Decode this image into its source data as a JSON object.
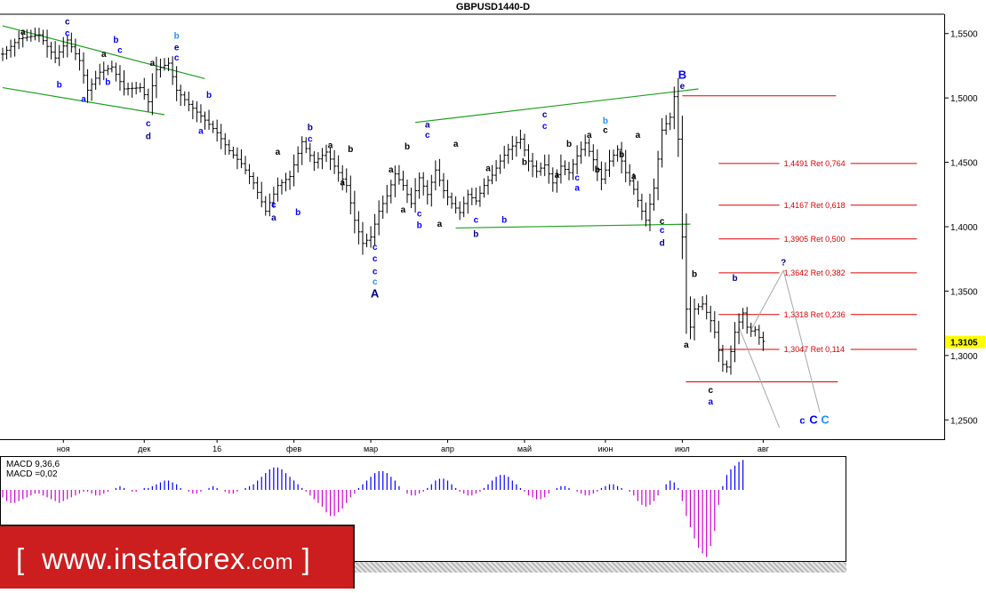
{
  "header": {
    "title": "GBPUSD1440-D"
  },
  "branding": {
    "site": "www.instaforex",
    "tld": ".com",
    "open": "[",
    "close": "]"
  },
  "macd": {
    "name": "MACD 9,36,6",
    "value": "MACD =0,02"
  },
  "chart_data": {
    "type": "ohlc",
    "title": "GBPUSD1440-D",
    "price_axis": {
      "ylim": [
        1.235,
        1.565
      ],
      "ticks": [
        1.25,
        1.3,
        1.35,
        1.4,
        1.45,
        1.5,
        1.55
      ],
      "tick_labels": [
        "1,2500",
        "1,3000",
        "1,3500",
        "1,4000",
        "1,4500",
        "1,5000",
        "1,5500"
      ],
      "current_price": 1.3105,
      "current_label": "1,3105"
    },
    "time_axis": {
      "labels": [
        "ноя",
        "дек",
        "16",
        "фев",
        "мар",
        "апр",
        "май",
        "июн",
        "июл",
        "авг"
      ],
      "label_bar_index": [
        15,
        35,
        53,
        72,
        91,
        110,
        129,
        149,
        168,
        188
      ],
      "total_bars": 205
    },
    "price_path": [
      [
        0,
        1.534
      ],
      [
        4,
        1.546
      ],
      [
        9,
        1.549
      ],
      [
        13,
        1.531
      ],
      [
        16,
        1.545
      ],
      [
        19,
        1.529
      ],
      [
        21,
        1.506
      ],
      [
        24,
        1.52
      ],
      [
        27,
        1.524
      ],
      [
        30,
        1.507
      ],
      [
        34,
        1.508
      ],
      [
        36,
        1.497
      ],
      [
        38,
        1.522
      ],
      [
        41,
        1.527
      ],
      [
        43,
        1.506
      ],
      [
        46,
        1.495
      ],
      [
        49,
        1.486
      ],
      [
        53,
        1.473
      ],
      [
        56,
        1.459
      ],
      [
        59,
        1.449
      ],
      [
        62,
        1.434
      ],
      [
        65,
        1.412
      ],
      [
        68,
        1.432
      ],
      [
        71,
        1.439
      ],
      [
        74,
        1.466
      ],
      [
        77,
        1.45
      ],
      [
        80,
        1.458
      ],
      [
        82,
        1.447
      ],
      [
        85,
        1.432
      ],
      [
        87,
        1.405
      ],
      [
        89,
        1.387
      ],
      [
        91,
        1.392
      ],
      [
        93,
        1.412
      ],
      [
        95,
        1.424
      ],
      [
        97,
        1.441
      ],
      [
        99,
        1.432
      ],
      [
        101,
        1.418
      ],
      [
        103,
        1.438
      ],
      [
        105,
        1.425
      ],
      [
        107,
        1.444
      ],
      [
        109,
        1.428
      ],
      [
        111,
        1.418
      ],
      [
        113,
        1.411
      ],
      [
        115,
        1.425
      ],
      [
        117,
        1.42
      ],
      [
        119,
        1.432
      ],
      [
        121,
        1.44
      ],
      [
        123,
        1.451
      ],
      [
        125,
        1.46
      ],
      [
        128,
        1.468
      ],
      [
        130,
        1.451
      ],
      [
        132,
        1.443
      ],
      [
        134,
        1.448
      ],
      [
        136,
        1.434
      ],
      [
        138,
        1.447
      ],
      [
        140,
        1.442
      ],
      [
        142,
        1.455
      ],
      [
        144,
        1.465
      ],
      [
        146,
        1.452
      ],
      [
        148,
        1.437
      ],
      [
        150,
        1.451
      ],
      [
        152,
        1.46
      ],
      [
        154,
        1.442
      ],
      [
        156,
        1.429
      ],
      [
        158,
        1.412
      ],
      [
        159,
        1.405
      ],
      [
        161,
        1.43
      ],
      [
        163,
        1.475
      ],
      [
        165,
        1.485
      ],
      [
        166,
        1.501
      ],
      [
        167,
        1.468
      ],
      [
        168,
        1.392
      ],
      [
        169,
        1.336
      ],
      [
        170,
        1.322
      ],
      [
        171,
        1.336
      ],
      [
        173,
        1.34
      ],
      [
        175,
        1.327
      ],
      [
        176,
        1.318
      ],
      [
        177,
        1.304
      ],
      [
        178,
        1.293
      ],
      [
        179,
        1.291
      ],
      [
        180,
        1.303
      ],
      [
        181,
        1.318
      ],
      [
        182,
        1.326
      ],
      [
        183,
        1.333
      ],
      [
        184,
        1.322
      ],
      [
        185,
        1.319
      ],
      [
        186,
        1.32
      ],
      [
        187,
        1.314
      ],
      [
        188,
        1.311
      ]
    ],
    "wave_labels": [
      {
        "text": "c",
        "x": 16,
        "y": 1.557,
        "style": "dark-blue"
      },
      {
        "text": "c",
        "x": 16,
        "y": 1.548,
        "style": "blue"
      },
      {
        "text": "a",
        "x": 5,
        "y": 1.549,
        "style": "black"
      },
      {
        "text": "b",
        "x": 28,
        "y": 1.543,
        "style": "blue"
      },
      {
        "text": "a",
        "x": 25,
        "y": 1.532,
        "style": "black"
      },
      {
        "text": "c",
        "x": 29,
        "y": 1.535,
        "style": "blue"
      },
      {
        "text": "a",
        "x": 37,
        "y": 1.525,
        "style": "black"
      },
      {
        "text": "b",
        "x": 43,
        "y": 1.546,
        "style": "teal"
      },
      {
        "text": "e",
        "x": 43,
        "y": 1.537,
        "style": "dark-blue"
      },
      {
        "text": "c",
        "x": 43,
        "y": 1.529,
        "style": "blue"
      },
      {
        "text": "b",
        "x": 14,
        "y": 1.508,
        "style": "blue"
      },
      {
        "text": "a",
        "x": 20,
        "y": 1.497,
        "style": "blue"
      },
      {
        "text": "b",
        "x": 26,
        "y": 1.51,
        "style": "blue"
      },
      {
        "text": "c",
        "x": 36,
        "y": 1.478,
        "style": "blue"
      },
      {
        "text": "d",
        "x": 36,
        "y": 1.468,
        "style": "dark-blue"
      },
      {
        "text": "b",
        "x": 51,
        "y": 1.5,
        "style": "blue"
      },
      {
        "text": "a",
        "x": 49,
        "y": 1.472,
        "style": "blue"
      },
      {
        "text": "a",
        "x": 68,
        "y": 1.456,
        "style": "black"
      },
      {
        "text": "c",
        "x": 67,
        "y": 1.415,
        "style": "blue"
      },
      {
        "text": "a",
        "x": 67,
        "y": 1.405,
        "style": "dark-blue"
      },
      {
        "text": "b",
        "x": 73,
        "y": 1.409,
        "style": "blue"
      },
      {
        "text": "b",
        "x": 76,
        "y": 1.475,
        "style": "dark-blue"
      },
      {
        "text": "c",
        "x": 76,
        "y": 1.466,
        "style": "blue"
      },
      {
        "text": "a",
        "x": 81,
        "y": 1.461,
        "style": "black"
      },
      {
        "text": "b",
        "x": 86,
        "y": 1.458,
        "style": "black"
      },
      {
        "text": "a",
        "x": 84,
        "y": 1.432,
        "style": "black"
      },
      {
        "text": "a",
        "x": 96,
        "y": 1.442,
        "style": "black"
      },
      {
        "text": "a",
        "x": 99,
        "y": 1.411,
        "style": "black"
      },
      {
        "text": "c",
        "x": 92,
        "y": 1.382,
        "style": "blue"
      },
      {
        "text": "c",
        "x": 92,
        "y": 1.373,
        "style": "blue"
      },
      {
        "text": "c",
        "x": 92,
        "y": 1.363,
        "style": "blue"
      },
      {
        "text": "c",
        "x": 92,
        "y": 1.355,
        "style": "teal"
      },
      {
        "text": "A",
        "x": 92,
        "y": 1.345,
        "style": "dark-blue-big"
      },
      {
        "text": "a",
        "x": 105,
        "y": 1.477,
        "style": "dark-blue"
      },
      {
        "text": "c",
        "x": 105,
        "y": 1.469,
        "style": "blue"
      },
      {
        "text": "b",
        "x": 100,
        "y": 1.46,
        "style": "black"
      },
      {
        "text": "a",
        "x": 112,
        "y": 1.462,
        "style": "black"
      },
      {
        "text": "c",
        "x": 103,
        "y": 1.408,
        "style": "blue"
      },
      {
        "text": "b",
        "x": 103,
        "y": 1.399,
        "style": "blue"
      },
      {
        "text": "a",
        "x": 108,
        "y": 1.4,
        "style": "black"
      },
      {
        "text": "a",
        "x": 120,
        "y": 1.443,
        "style": "black"
      },
      {
        "text": "c",
        "x": 117,
        "y": 1.403,
        "style": "blue"
      },
      {
        "text": "b",
        "x": 117,
        "y": 1.392,
        "style": "dark-blue"
      },
      {
        "text": "b",
        "x": 124,
        "y": 1.403,
        "style": "blue"
      },
      {
        "text": "b",
        "x": 129,
        "y": 1.448,
        "style": "black"
      },
      {
        "text": "c",
        "x": 134,
        "y": 1.485,
        "style": "dark-blue"
      },
      {
        "text": "c",
        "x": 134,
        "y": 1.476,
        "style": "blue"
      },
      {
        "text": "b",
        "x": 140,
        "y": 1.462,
        "style": "black"
      },
      {
        "text": "a",
        "x": 137,
        "y": 1.438,
        "style": "black"
      },
      {
        "text": "c",
        "x": 142,
        "y": 1.436,
        "style": "blue"
      },
      {
        "text": "a",
        "x": 142,
        "y": 1.428,
        "style": "blue"
      },
      {
        "text": "b",
        "x": 147,
        "y": 1.442,
        "style": "black"
      },
      {
        "text": "b",
        "x": 149,
        "y": 1.48,
        "style": "teal"
      },
      {
        "text": "c",
        "x": 149,
        "y": 1.473,
        "style": "black"
      },
      {
        "text": "a",
        "x": 145,
        "y": 1.469,
        "style": "black"
      },
      {
        "text": "a",
        "x": 157,
        "y": 1.469,
        "style": "black"
      },
      {
        "text": "b",
        "x": 153,
        "y": 1.454,
        "style": "black"
      },
      {
        "text": "a",
        "x": 156,
        "y": 1.437,
        "style": "black"
      },
      {
        "text": "c",
        "x": 163,
        "y": 1.395,
        "style": "blue"
      },
      {
        "text": "d",
        "x": 163,
        "y": 1.385,
        "style": "dark-blue"
      },
      {
        "text": "c",
        "x": 163,
        "y": 1.402,
        "style": "black"
      },
      {
        "text": "B",
        "x": 168,
        "y": 1.515,
        "style": "blue-big"
      },
      {
        "text": "e",
        "x": 168,
        "y": 1.507,
        "style": "dark-blue"
      },
      {
        "text": "b",
        "x": 171,
        "y": 1.361,
        "style": "black"
      },
      {
        "text": "a",
        "x": 169,
        "y": 1.306,
        "style": "black"
      },
      {
        "text": "c",
        "x": 175,
        "y": 1.271,
        "style": "black"
      },
      {
        "text": "a",
        "x": 175,
        "y": 1.262,
        "style": "blue"
      },
      {
        "text": "b",
        "x": 181,
        "y": 1.358,
        "style": "dark-blue"
      },
      {
        "text": "?",
        "x": 193,
        "y": 1.37,
        "style": "dark-blue"
      }
    ],
    "projection": {
      "label": "?",
      "label_bar": 193,
      "final_labels": [
        {
          "text": "c",
          "style": "blue"
        },
        {
          "text": "C",
          "style": "blue-big"
        },
        {
          "text": "C",
          "style": "teal-big"
        }
      ],
      "lines": [
        [
          [
            185,
            1.32
          ],
          [
            193,
            1.366
          ],
          [
            202,
            1.256
          ]
        ],
        [
          [
            182,
            1.322
          ],
          [
            192,
            1.244
          ]
        ]
      ]
    },
    "trendlines": [
      {
        "from": [
          0,
          1.556
        ],
        "to": [
          50,
          1.515
        ]
      },
      {
        "from": [
          0,
          1.508
        ],
        "to": [
          40,
          1.487
        ]
      },
      {
        "from": [
          102,
          1.481
        ],
        "to": [
          172,
          1.507
        ]
      },
      {
        "from": [
          112,
          1.399
        ],
        "to": [
          170,
          1.402
        ]
      }
    ],
    "fibonacci": {
      "high": 1.5017,
      "low": 1.2795,
      "start_bar": 168,
      "end_bar": 206,
      "levels": [
        {
          "price": 1.4491,
          "label": "1,4491 Ret 0,764"
        },
        {
          "price": 1.4167,
          "label": "1,4167 Ret 0,618"
        },
        {
          "price": 1.3905,
          "label": "1,3905 Ret 0,500"
        },
        {
          "price": 1.3642,
          "label": "1,3642 Ret 0,382"
        },
        {
          "price": 1.3318,
          "label": "1,3318 Ret 0,236"
        },
        {
          "price": 1.3047,
          "label": "1,3047 Ret 0,114"
        }
      ]
    },
    "macd_values": [
      -4,
      -6,
      -7,
      -7,
      -6,
      -5,
      -4,
      -3,
      -2,
      -2,
      -3,
      -4,
      -5,
      -6,
      -7,
      -6,
      -5,
      -4,
      -3,
      -2,
      -1,
      -1,
      -2,
      -3,
      -3,
      -2,
      -1,
      0,
      1,
      2,
      1,
      0,
      -1,
      -1,
      0,
      1,
      1,
      2,
      3,
      4,
      5,
      5,
      4,
      3,
      1,
      0,
      -1,
      -2,
      -2,
      -1,
      0,
      1,
      2,
      1,
      0,
      -1,
      -2,
      -2,
      -1,
      0,
      1,
      2,
      3,
      5,
      7,
      9,
      11,
      12,
      12,
      11,
      9,
      7,
      5,
      3,
      1,
      -1,
      -3,
      -5,
      -7,
      -9,
      -12,
      -14,
      -14,
      -12,
      -10,
      -7,
      -4,
      -2,
      1,
      3,
      5,
      7,
      9,
      10,
      10,
      9,
      7,
      5,
      2,
      0,
      -2,
      -3,
      -3,
      -2,
      -1,
      1,
      3,
      5,
      6,
      6,
      5,
      3,
      1,
      -1,
      -2,
      -3,
      -3,
      -2,
      -1,
      1,
      3,
      5,
      7,
      8,
      8,
      7,
      5,
      3,
      1,
      -1,
      -3,
      -4,
      -5,
      -5,
      -4,
      -2,
      0,
      1,
      2,
      2,
      1,
      0,
      -1,
      -2,
      -3,
      -3,
      -2,
      -1,
      1,
      2,
      3,
      3,
      2,
      1,
      0,
      -1,
      -3,
      -6,
      -8,
      -9,
      -8,
      -6,
      -3,
      0,
      3,
      5,
      4,
      1,
      -6,
      -14,
      -20,
      -26,
      -31,
      -34,
      -36,
      -30,
      -22,
      -8,
      2,
      8,
      11,
      13,
      15,
      16
    ]
  }
}
